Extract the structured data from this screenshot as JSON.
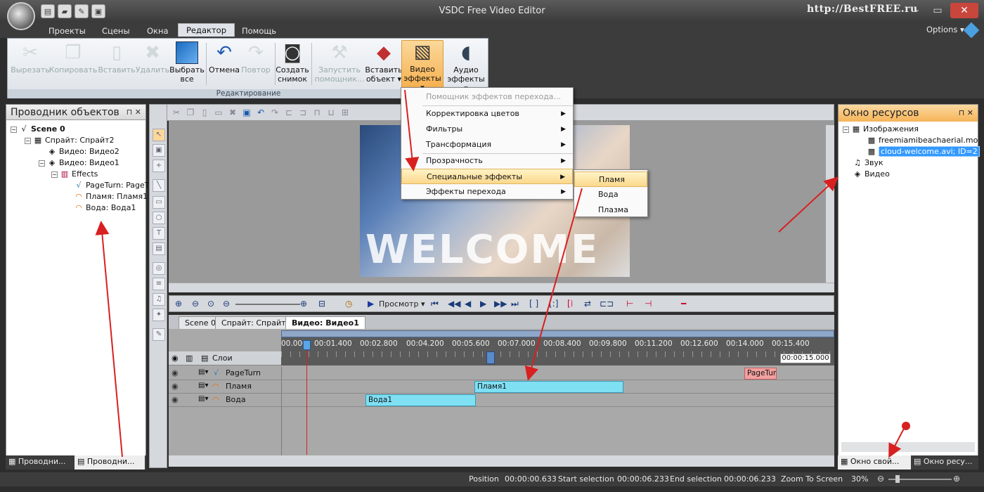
{
  "window": {
    "title": "VSDC Free Video Editor",
    "watermark": "http://BestFREE.ru",
    "close": "✕"
  },
  "menu": {
    "tabs": [
      "Проекты",
      "Сцены",
      "Окна",
      "Редактор",
      "Помощь"
    ],
    "active": "Редактор",
    "options": "Options ▾"
  },
  "ribbon": {
    "buttons": [
      {
        "label": "Вырезать",
        "icon": "scissors-icon",
        "disabled": true
      },
      {
        "label": "Копировать",
        "icon": "copy-icon",
        "disabled": true
      },
      {
        "label": "Вставить",
        "icon": "paste-icon",
        "disabled": true
      },
      {
        "label": "Удалить",
        "icon": "delete-icon",
        "disabled": true
      },
      {
        "label": "Выбрать все",
        "icon": "select-all-icon",
        "disabled": false
      },
      {
        "label": "Отмена",
        "icon": "undo-icon",
        "disabled": false
      },
      {
        "label": "Повтор",
        "icon": "redo-icon",
        "disabled": true
      },
      {
        "label": "Создать снимок",
        "icon": "camera-icon",
        "disabled": false
      },
      {
        "label": "Запустить помощник...",
        "icon": "wizard-icon",
        "disabled": true
      },
      {
        "label": "Вставить объект ▾",
        "icon": "shapes-icon",
        "disabled": false
      },
      {
        "label": "Видео эффекты ▾",
        "icon": "clapper-icon",
        "disabled": false
      },
      {
        "label": "Аудио эффекты ▾",
        "icon": "speaker-icon",
        "disabled": false
      }
    ],
    "group_label": "Редактирование"
  },
  "left_panel": {
    "title": "Проводник объектов",
    "tree": [
      {
        "label": "Scene 0",
        "bold": true
      },
      {
        "label": "Спрайт: Спрайт2"
      },
      {
        "label": "Видео: Видео2"
      },
      {
        "label": "Видео: Видео1"
      },
      {
        "label": "Effects"
      },
      {
        "label": "PageTurn: PageT"
      },
      {
        "label": "Пламя: Пламя1"
      },
      {
        "label": "Вода: Вода1"
      }
    ],
    "bottom_tabs": [
      "Проводни...",
      "Проводни..."
    ]
  },
  "canvas": {
    "welcome_text": "WELCOME"
  },
  "playback": {
    "preview_label": "Просмотр ▾"
  },
  "dropdown": {
    "items": [
      {
        "label": "Помощник эффектов перехода...",
        "disabled": true,
        "arrow": ""
      },
      {
        "label": "Корректировка цветов",
        "arrow": "▶"
      },
      {
        "label": "Фильтры",
        "arrow": "▶"
      },
      {
        "label": "Трансформация",
        "arrow": "▶"
      },
      {
        "label": "Прозрачность",
        "arrow": "▶"
      },
      {
        "label": "Специальные эффекты",
        "arrow": "▶",
        "highlight": true
      },
      {
        "label": "Эффекты перехода",
        "arrow": "▶"
      }
    ],
    "submenu": [
      {
        "label": "Пламя",
        "highlight": true
      },
      {
        "label": "Вода"
      },
      {
        "label": "Плазма"
      }
    ]
  },
  "timeline": {
    "tabs": [
      "Scene 0",
      "Спрайт: Спрайт2",
      "Видео: Видео1"
    ],
    "active_tab": "Видео: Видео1",
    "layers_header": "Слои",
    "ruler": [
      "00.000",
      "00:01.400",
      "00:02.800",
      "00:04.200",
      "00:05.600",
      "00:07.000",
      "00:08.400",
      "00:09.800",
      "00:11.200",
      "00:12.600",
      "00:14.000",
      "00:15.400"
    ],
    "duration": "00:00:15.000",
    "layers": [
      {
        "name": "PageTurn",
        "clip": "PageTur"
      },
      {
        "name": "Пламя",
        "clip": "Пламя1"
      },
      {
        "name": "Вода",
        "clip": "Вода1"
      }
    ]
  },
  "right_panel": {
    "title": "Окно ресурсов",
    "tree": [
      {
        "label": "Изображения"
      },
      {
        "label": "freemiamibeachaerial.mov; I"
      },
      {
        "label": "cloud-welcome.avi; ID=2",
        "selected": true
      },
      {
        "label": "Звук"
      },
      {
        "label": "Видео"
      }
    ],
    "bottom_tabs": [
      "Окно свой...",
      "Окно ресу..."
    ]
  },
  "status": {
    "position_label": "Position",
    "position": "00:00:00.633",
    "start_label": "Start selection",
    "start": "00:00:06.233",
    "end_label": "End selection",
    "end": "00:00:06.233",
    "zoom_label": "Zoom To Screen",
    "zoom": "30%"
  },
  "colors": {
    "accent": "#f6b458",
    "selection": "#3399ff",
    "arrow": "#d82020",
    "clip": "#7fe0f4"
  }
}
